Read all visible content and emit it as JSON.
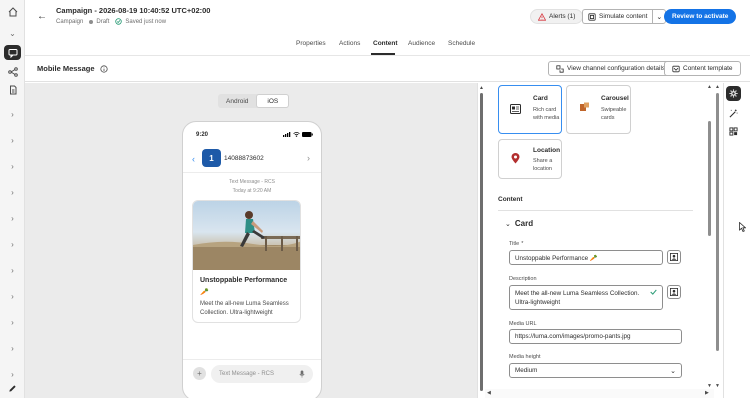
{
  "header": {
    "title": "Campaign - 2026-08-19 10:40:52 UTC+02:00",
    "breadcrumb": "Campaign",
    "status": "Draft",
    "saved": "Saved just now",
    "alerts_label": "Alerts (1)",
    "simulate_label": "Simulate content",
    "review_label": "Review to activate"
  },
  "tabs": [
    {
      "label": "Properties"
    },
    {
      "label": "Actions"
    },
    {
      "label": "Content"
    },
    {
      "label": "Audience"
    },
    {
      "label": "Schedule"
    }
  ],
  "toolbar": {
    "section_title": "Mobile Message",
    "channel_details_label": "View channel configuration details",
    "content_template_label": "Content template"
  },
  "preview": {
    "os_options": [
      "Android",
      "iOS"
    ],
    "selected_os": "iOS",
    "time": "9:20",
    "contact_number": "14088873602",
    "avatar_text": "1",
    "message_meta": "Text Message - RCS",
    "message_time": "Today at 9:20 AM",
    "card_title": "Unstoppable Performance",
    "card_emoji": "🥕",
    "card_description": "Meet the all-new Luma Seamless Collection. Ultra-lightweight",
    "input_placeholder": "Text Message - RCS"
  },
  "panel": {
    "types": [
      {
        "title": "Card",
        "desc": "Rich card with media"
      },
      {
        "title": "Carousel",
        "desc": "Swipeable cards"
      },
      {
        "title": "Location",
        "desc": "Share a location"
      }
    ],
    "content_heading": "Content",
    "card_section": "Card",
    "title_label": "Title",
    "title_required": "*",
    "title_value": "Unstoppable Performance 🥕",
    "description_label": "Description",
    "description_value": "Meet the all-new Luma Seamless Collection. Ultra-lightweight",
    "media_url_label": "Media URL",
    "media_url_value": "https://luma.com/images/promo-pants.jpg",
    "media_height_label": "Media height",
    "media_height_value": "Medium"
  },
  "colors": {
    "accent": "#1473e6",
    "selected_border": "#378ef0",
    "alert": "#d7373f",
    "success": "#2d9d78"
  }
}
